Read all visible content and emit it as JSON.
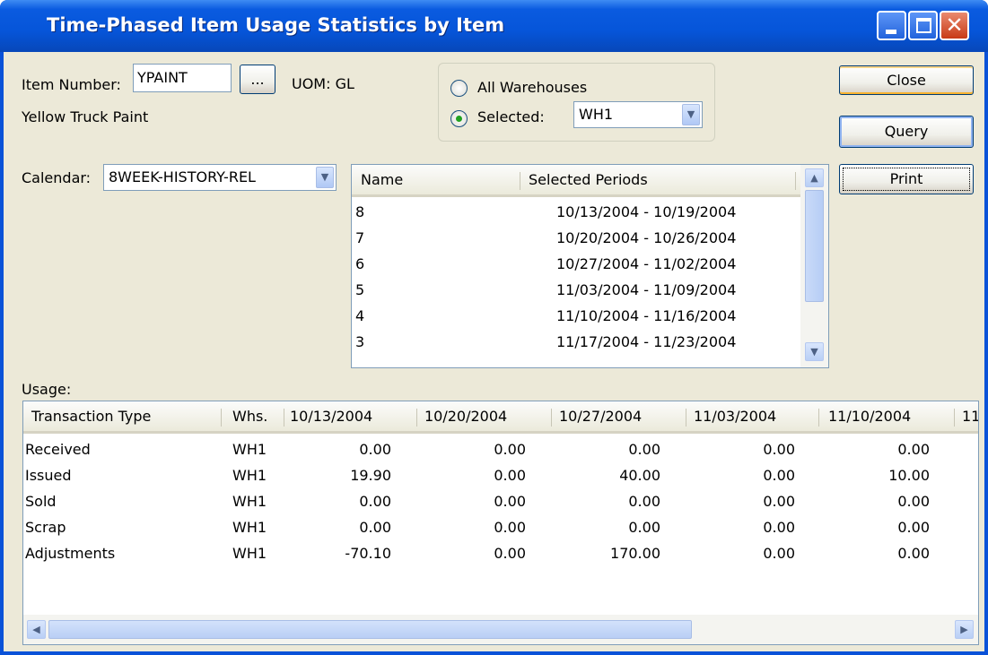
{
  "window": {
    "title": "Time-Phased Item Usage Statistics by Item"
  },
  "item": {
    "label": "Item Number:",
    "value": "YPAINT",
    "lookup_label": "...",
    "uom_label": "UOM:",
    "uom_value": "GL",
    "description": "Yellow Truck Paint"
  },
  "warehouse": {
    "all_label": "All Warehouses",
    "selected_label": "Selected:",
    "selected_value": "WH1",
    "mode": "selected"
  },
  "buttons": {
    "close": "Close",
    "query": "Query",
    "print": "Print"
  },
  "calendar": {
    "label": "Calendar:",
    "value": "8WEEK-HISTORY-REL"
  },
  "periods": {
    "columns": [
      "Name",
      "Selected Periods"
    ],
    "rows": [
      {
        "name": "8",
        "range": "10/13/2004 - 10/19/2004"
      },
      {
        "name": "7",
        "range": "10/20/2004 - 10/26/2004"
      },
      {
        "name": "6",
        "range": "10/27/2004 - 11/02/2004"
      },
      {
        "name": "5",
        "range": "11/03/2004 - 11/09/2004"
      },
      {
        "name": "4",
        "range": "11/10/2004 - 11/16/2004"
      },
      {
        "name": "3",
        "range": "11/17/2004 - 11/23/2004"
      }
    ]
  },
  "usage": {
    "label": "Usage:",
    "columns": [
      "Transaction Type",
      "Whs.",
      "10/13/2004",
      "10/20/2004",
      "10/27/2004",
      "11/03/2004",
      "11/10/2004",
      "11"
    ],
    "rows": [
      {
        "type": "Received",
        "whs": "WH1",
        "values": [
          "0.00",
          "0.00",
          "0.00",
          "0.00",
          "0.00"
        ]
      },
      {
        "type": "Issued",
        "whs": "WH1",
        "values": [
          "19.90",
          "0.00",
          "40.00",
          "0.00",
          "10.00"
        ]
      },
      {
        "type": "Sold",
        "whs": "WH1",
        "values": [
          "0.00",
          "0.00",
          "0.00",
          "0.00",
          "0.00"
        ]
      },
      {
        "type": "Scrap",
        "whs": "WH1",
        "values": [
          "0.00",
          "0.00",
          "0.00",
          "0.00",
          "0.00"
        ]
      },
      {
        "type": "Adjustments",
        "whs": "WH1",
        "values": [
          "-70.10",
          "0.00",
          "170.00",
          "0.00",
          "0.00"
        ]
      }
    ]
  },
  "icons": {
    "minimize": "minimize-icon",
    "maximize": "maximize-icon",
    "close": "close-icon",
    "dropdown": "chevron-down-icon",
    "scroll_up": "arrow-up-icon",
    "scroll_down": "arrow-down-icon",
    "scroll_left": "arrow-left-icon",
    "scroll_right": "arrow-right-icon"
  },
  "colors": {
    "titlebar": "#0655d9",
    "face": "#ece9d8",
    "radio_dot": "#21a121"
  }
}
